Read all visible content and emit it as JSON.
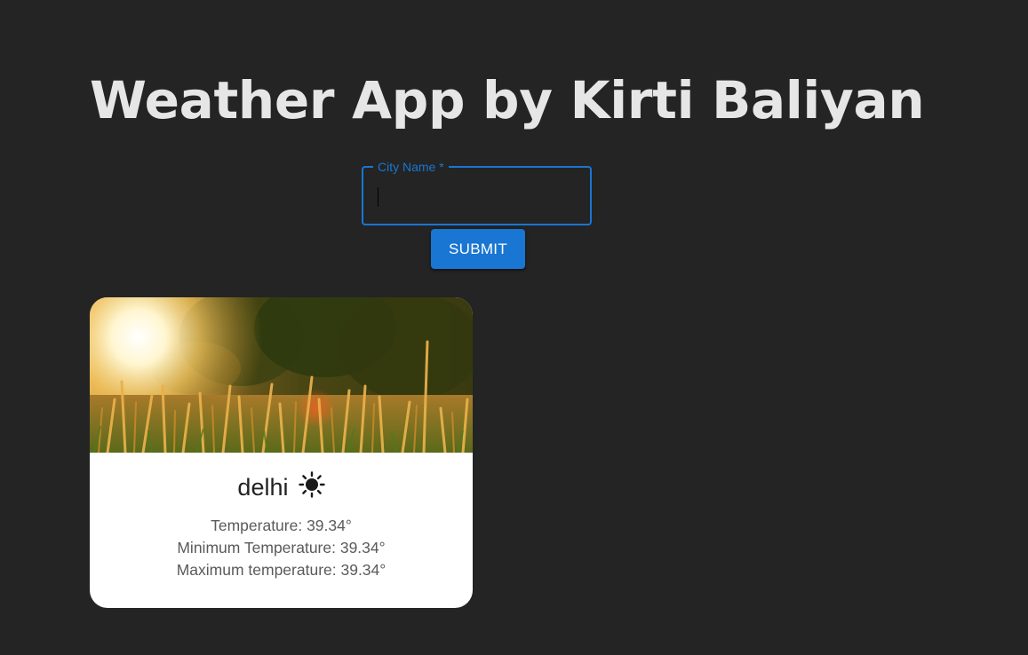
{
  "header": {
    "title": "Weather App by Kirti Baliyan"
  },
  "search": {
    "label": "City Name *",
    "value": "",
    "submit_label": "SUBMIT"
  },
  "card": {
    "city": "delhi",
    "condition_icon": "sun-icon",
    "temperature": "Temperature: 39.34°",
    "min_temperature": "Minimum Temperature: 39.34°",
    "max_temperature": "Maximum temperature: 39.34°"
  },
  "colors": {
    "background": "#242424",
    "accent": "#1976d2",
    "title": "#e6e6e6",
    "card": "#ffffff"
  }
}
